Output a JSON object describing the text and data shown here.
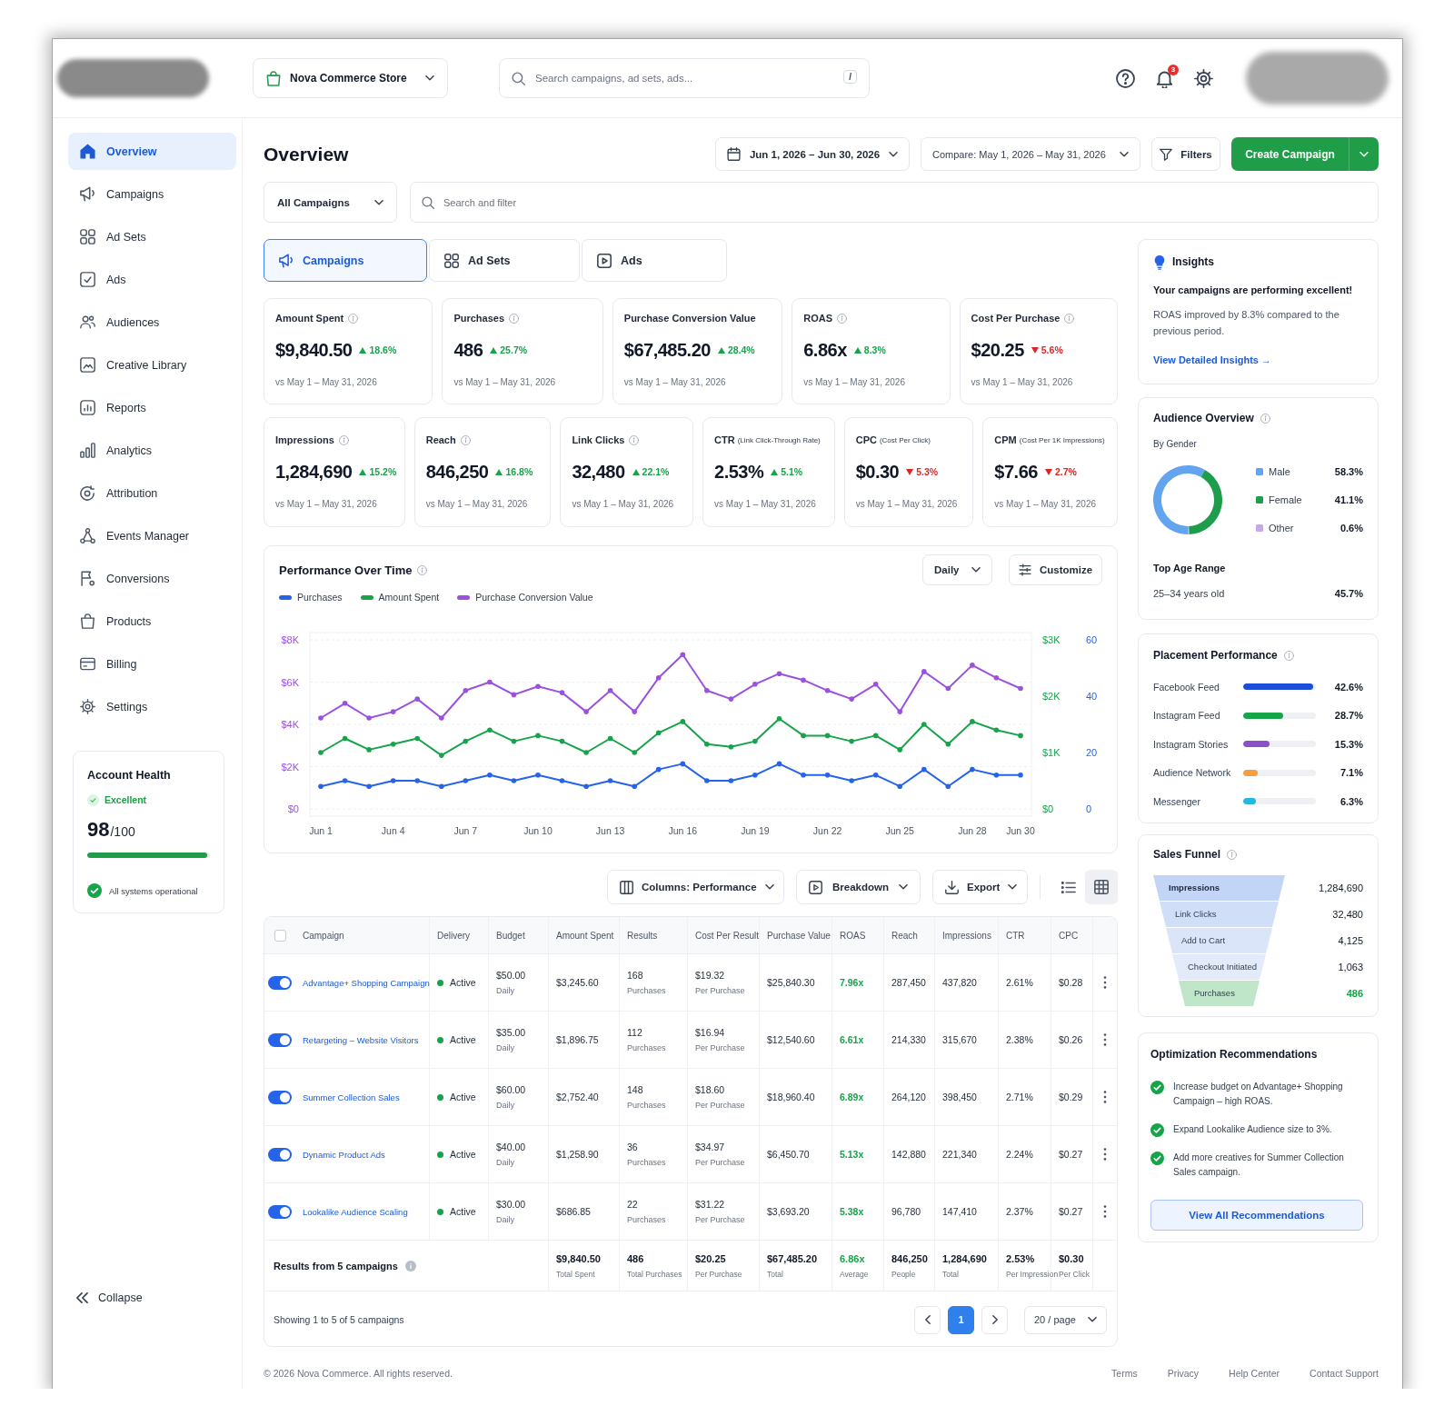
{
  "header": {
    "store": "Nova Commerce Store",
    "search": {
      "placeholder": "Search campaigns, ad sets, ads...",
      "shortcut": "/"
    },
    "notifications": {
      "count": "3"
    }
  },
  "sidebar": {
    "items": [
      {
        "label": "Overview",
        "selected": true
      },
      {
        "label": "Campaigns",
        "selected": false
      },
      {
        "label": "Ad Sets",
        "selected": false
      },
      {
        "label": "Ads",
        "selected": false
      },
      {
        "label": "Audiences",
        "selected": false
      },
      {
        "label": "Creative Library",
        "selected": false
      },
      {
        "label": "Reports",
        "selected": false
      },
      {
        "label": "Analytics",
        "selected": false
      },
      {
        "label": "Attribution",
        "selected": false
      },
      {
        "label": "Events Manager",
        "selected": false
      },
      {
        "label": "Conversions",
        "selected": false
      },
      {
        "label": "Products",
        "selected": false
      },
      {
        "label": "Billing",
        "selected": false
      },
      {
        "label": "Settings",
        "selected": false
      }
    ],
    "account_health": {
      "title": "Account Health",
      "status": "Excellent",
      "score": "98",
      "score_max": "/100",
      "level": 0.98,
      "message": "All systems operational"
    },
    "collapse": "Collapse"
  },
  "page": {
    "title": "Overview",
    "date_range": "Jun 1, 2026 – Jun 30, 2026",
    "compare": "Compare: May 1, 2026 – May 31, 2026",
    "filters": "Filters",
    "create_button": "Create Campaign"
  },
  "filter_bar": {
    "scope": "All Campaigns",
    "search": {
      "placeholder": "Search and filter"
    }
  },
  "tabs": [
    {
      "label": "Campaigns",
      "selected": true
    },
    {
      "label": "Ad Sets",
      "selected": false
    },
    {
      "label": "Ads",
      "selected": false
    }
  ],
  "kpi_rows": [
    [
      {
        "label": "Amount Spent",
        "info": true,
        "value": "$9,840.50",
        "change": "18.6%",
        "rising": true,
        "comparison": "vs May 1 – May 31, 2026"
      },
      {
        "label": "Purchases",
        "info": true,
        "value": "486",
        "change": "25.7%",
        "rising": true,
        "comparison": "vs May 1 – May 31, 2026"
      },
      {
        "label": "Purchase Conversion Value",
        "info": false,
        "value": "$67,485.20",
        "change": "28.4%",
        "rising": true,
        "comparison": "vs May 1 – May 31, 2026"
      },
      {
        "label": "ROAS",
        "info": true,
        "value": "6.86x",
        "change": "8.3%",
        "rising": true,
        "comparison": "vs May 1 – May 31, 2026"
      },
      {
        "label": "Cost Per Purchase",
        "info": true,
        "value": "$20.25",
        "change": "5.6%",
        "rising": false,
        "comparison": "vs May 1 – May 31, 2026"
      }
    ],
    [
      {
        "label": "Impressions",
        "info": true,
        "value": "1,284,690",
        "change": "15.2%",
        "rising": true,
        "comparison": "vs May 1 – May 31, 2026"
      },
      {
        "label": "Reach",
        "info": true,
        "value": "846,250",
        "change": "16.8%",
        "rising": true,
        "comparison": "vs May 1 – May 31, 2026"
      },
      {
        "label": "Link Clicks",
        "info": true,
        "value": "32,480",
        "change": "22.1%",
        "rising": true,
        "comparison": "vs May 1 – May 31, 2026"
      },
      {
        "label": "CTR",
        "note": "(Link Click-Through Rate)",
        "info": false,
        "value": "2.53%",
        "change": "5.1%",
        "rising": true,
        "comparison": "vs May 1 – May 31, 2026"
      },
      {
        "label": "CPC",
        "note": "(Cost Per Click)",
        "info": false,
        "value": "$0.30",
        "change": "5.3%",
        "rising": false,
        "comparison": "vs May 1 – May 31, 2026"
      },
      {
        "label": "CPM",
        "note": "(Cost Per 1K Impressions)",
        "info": false,
        "value": "$7.66",
        "change": "2.7%",
        "rising": false,
        "comparison": "vs May 1 – May 31, 2026"
      }
    ]
  ],
  "performance": {
    "title": "Performance Over Time",
    "interval": "Daily",
    "customize": "Customize",
    "chart_data": {
      "type": "line",
      "grid": true,
      "categories": [
        "Jun 1",
        null,
        null,
        "Jun 4",
        null,
        null,
        "Jun 7",
        null,
        null,
        "Jun 10",
        null,
        null,
        "Jun 13",
        null,
        null,
        "Jun 16",
        null,
        null,
        "Jun 19",
        null,
        null,
        "Jun 22",
        null,
        null,
        "Jun 25",
        null,
        null,
        "Jun 28",
        null,
        "Jun 30"
      ],
      "ylim": [
        0,
        8000
      ],
      "yticks": [
        {
          "value": 0,
          "label": "$0"
        },
        {
          "value": 2000,
          "label": "$2K"
        },
        {
          "value": 4000,
          "label": "$4K"
        },
        {
          "value": 6000,
          "label": "$6K"
        },
        {
          "value": 8000,
          "label": "$8K"
        }
      ],
      "y2lim": [
        0,
        3000
      ],
      "y2ticks": [
        {
          "value": 0,
          "label": "$0"
        },
        {
          "value": 1000,
          "label": "$1K"
        },
        {
          "value": 2000,
          "label": "$2K"
        },
        {
          "value": 3000,
          "label": "$3K"
        }
      ],
      "y3lim": [
        0,
        60
      ],
      "y3ticks": [
        {
          "value": 0,
          "label": "0"
        },
        {
          "value": 20,
          "label": "20"
        },
        {
          "value": 40,
          "label": "40"
        },
        {
          "value": 60,
          "label": "60"
        }
      ],
      "series": [
        {
          "name": "Purchases",
          "color": "#2563eb",
          "axis": "y3",
          "values": [
            8,
            10,
            8,
            10,
            10,
            8,
            10,
            12,
            10,
            12,
            10,
            8,
            10,
            8,
            14,
            16,
            10,
            10,
            12,
            16,
            12,
            12,
            10,
            12,
            8,
            14,
            8,
            14,
            12,
            12
          ]
        },
        {
          "name": "Amount Spent",
          "color": "#16a34a",
          "axis": "y2",
          "values": [
            1000,
            1250,
            1050,
            1150,
            1250,
            950,
            1200,
            1400,
            1200,
            1300,
            1200,
            1000,
            1250,
            1000,
            1350,
            1550,
            1150,
            1100,
            1200,
            1600,
            1300,
            1300,
            1200,
            1300,
            1050,
            1500,
            1150,
            1550,
            1400,
            1300
          ]
        },
        {
          "name": "Purchase Conversion Value",
          "color": "#9b51e0",
          "values": [
            4300,
            5000,
            4300,
            4600,
            5200,
            4300,
            5600,
            6000,
            5400,
            5800,
            5500,
            4600,
            5600,
            4600,
            6200,
            7300,
            5600,
            5200,
            5900,
            6400,
            6100,
            5600,
            5200,
            5900,
            4600,
            6500,
            5700,
            6800,
            6200,
            5700
          ]
        }
      ]
    }
  },
  "toolbar": {
    "columns": "Columns: Performance",
    "breakdown": "Breakdown",
    "export": "Export",
    "views": [
      {
        "kind": "list",
        "selected": false
      },
      {
        "kind": "grid",
        "selected": true
      }
    ]
  },
  "table": {
    "select_all": {
      "checked": false
    },
    "columns": [
      "Campaign",
      "Delivery",
      "Budget",
      "Amount Spent",
      "Results",
      "Cost Per Result",
      "Purchase Value",
      "ROAS",
      "Reach",
      "Impressions",
      "CTR",
      "CPC"
    ],
    "rows": [
      {
        "on": true,
        "campaign": "Advantage+ Shopping Campaign",
        "delivery": {
          "label": "Active",
          "active": true
        },
        "budget": "$50.00",
        "budget_period": "Daily",
        "amount_spent": "$3,245.60",
        "results": "168",
        "results_unit": "Purchases",
        "cost_per_result": "$19.32",
        "cost_unit": "Per Purchase",
        "purchase_value": "$25,840.30",
        "roas": "7.96x",
        "reach": "287,450",
        "impressions": "437,820",
        "ctr": "2.61%",
        "cpc": "$0.28"
      },
      {
        "on": true,
        "campaign": "Retargeting – Website Visitors",
        "delivery": {
          "label": "Active",
          "active": true
        },
        "budget": "$35.00",
        "budget_period": "Daily",
        "amount_spent": "$1,896.75",
        "results": "112",
        "results_unit": "Purchases",
        "cost_per_result": "$16.94",
        "cost_unit": "Per Purchase",
        "purchase_value": "$12,540.60",
        "roas": "6.61x",
        "reach": "214,330",
        "impressions": "315,670",
        "ctr": "2.38%",
        "cpc": "$0.26"
      },
      {
        "on": true,
        "campaign": "Summer Collection Sales",
        "delivery": {
          "label": "Active",
          "active": true
        },
        "budget": "$60.00",
        "budget_period": "Daily",
        "amount_spent": "$2,752.40",
        "results": "148",
        "results_unit": "Purchases",
        "cost_per_result": "$18.60",
        "cost_unit": "Per Purchase",
        "purchase_value": "$18,960.40",
        "roas": "6.89x",
        "reach": "264,120",
        "impressions": "398,450",
        "ctr": "2.71%",
        "cpc": "$0.29"
      },
      {
        "on": true,
        "campaign": "Dynamic Product Ads",
        "delivery": {
          "label": "Active",
          "active": true
        },
        "budget": "$40.00",
        "budget_period": "Daily",
        "amount_spent": "$1,258.90",
        "results": "36",
        "results_unit": "Purchases",
        "cost_per_result": "$34.97",
        "cost_unit": "Per Purchase",
        "purchase_value": "$6,450.70",
        "roas": "5.13x",
        "reach": "142,880",
        "impressions": "221,340",
        "ctr": "2.24%",
        "cpc": "$0.27"
      },
      {
        "on": true,
        "campaign": "Lookalike Audience Scaling",
        "delivery": {
          "label": "Active",
          "active": true
        },
        "budget": "$30.00",
        "budget_period": "Daily",
        "amount_spent": "$686.85",
        "results": "22",
        "results_unit": "Purchases",
        "cost_per_result": "$31.22",
        "cost_unit": "Per Purchase",
        "purchase_value": "$3,693.20",
        "roas": "5.38x",
        "reach": "96,780",
        "impressions": "147,410",
        "ctr": "2.37%",
        "cpc": "$0.27"
      }
    ],
    "summary": {
      "label": "Results from 5 campaigns",
      "cells": [
        {
          "value": "$9,840.50",
          "caption": "Total Spent",
          "highlight": false
        },
        {
          "value": "486",
          "caption": "Total Purchases",
          "highlight": false
        },
        {
          "value": "$20.25",
          "caption": "Per Purchase",
          "highlight": false
        },
        {
          "value": "$67,485.20",
          "caption": "Total",
          "highlight": false
        },
        {
          "value": "6.86x",
          "caption": "Average",
          "highlight": true
        },
        {
          "value": "846,250",
          "caption": "People",
          "highlight": false
        },
        {
          "value": "1,284,690",
          "caption": "Total",
          "highlight": false
        },
        {
          "value": "2.53%",
          "caption": "Per Impression",
          "highlight": false
        },
        {
          "value": "$0.30",
          "caption": "Per Click",
          "highlight": false
        }
      ]
    },
    "pagination": {
      "summary": "Showing 1 to 5 of 5 campaigns",
      "pages": [
        {
          "label": "1",
          "selected": true
        }
      ],
      "page_size": "20 / page"
    }
  },
  "insights": {
    "title": "Insights",
    "headline": "Your campaigns are performing excellent!",
    "body": "ROAS improved by 8.3% compared to the previous period.",
    "link": "View Detailed Insights →"
  },
  "audience": {
    "title": "Audience Overview",
    "subtitle": "By Gender",
    "chart_data": {
      "type": "donut",
      "categories": [
        "Male",
        "Female",
        "Other"
      ],
      "values": [
        58.3,
        41.1,
        0.6
      ]
    },
    "legend": [
      {
        "value": "58.3%",
        "color": "#62a4ee"
      },
      {
        "value": "41.1%",
        "color": "#1e9e4a"
      },
      {
        "value": "0.6%",
        "color": "#c7a6ee"
      }
    ],
    "age": {
      "title": "Top Age Range",
      "range": "25–34 years old",
      "share": "45.7%"
    }
  },
  "placement": {
    "title": "Placement Performance",
    "items": [
      {
        "label": "Facebook Feed",
        "level": 0.96,
        "value": "42.6%",
        "color": "#1d4ed8"
      },
      {
        "label": "Instagram Feed",
        "level": 0.55,
        "value": "28.7%",
        "color": "#16a34a"
      },
      {
        "label": "Instagram Stories",
        "level": 0.36,
        "value": "15.3%",
        "color": "#8b4fc9"
      },
      {
        "label": "Audience Network",
        "level": 0.2,
        "value": "7.1%",
        "color": "#f59e42"
      },
      {
        "label": "Messenger",
        "level": 0.18,
        "value": "6.3%",
        "color": "#22b8e0"
      }
    ]
  },
  "funnel": {
    "title": "Sales Funnel",
    "stages": [
      {
        "label": "Impressions",
        "value": "1,284,690",
        "color": "#c3d5f6",
        "highlight": false
      },
      {
        "label": "Link Clicks",
        "value": "32,480",
        "color": "#d1def8",
        "highlight": false
      },
      {
        "label": "Add to Cart",
        "value": "4,125",
        "color": "#dbe5f9",
        "highlight": false
      },
      {
        "label": "Checkout Initiated",
        "value": "1,063",
        "color": "#e3ebfa",
        "highlight": false
      },
      {
        "label": "Purchases",
        "value": "486",
        "color": "#bfe6c9",
        "highlight": true
      }
    ]
  },
  "recommendations": {
    "title": "Optimization Recommendations",
    "items": [
      "Increase budget on Advantage+ Shopping Campaign – high ROAS.",
      "Expand Lookalike Audience size to 3%.",
      "Add more creatives for Summer Collection Sales campaign."
    ],
    "button": "View All Recommendations"
  },
  "footer": {
    "copyright": "© 2026 Nova Commerce. All rights reserved.",
    "links": [
      "Terms",
      "Privacy",
      "Help Center",
      "Contact Support"
    ]
  }
}
